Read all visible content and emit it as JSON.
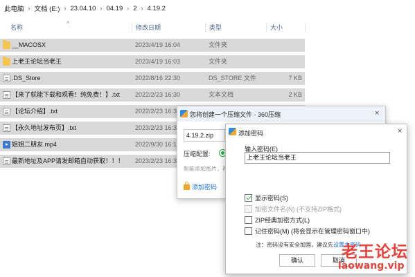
{
  "breadcrumb": [
    "此电脑",
    "文档 (E:)",
    "23.04.10",
    "04.19",
    "2",
    "4.19.2"
  ],
  "columns": {
    "name": "名称",
    "date": "修改日期",
    "type": "类型",
    "size": "大小"
  },
  "files": [
    {
      "name": "__MACOSX",
      "date": "2023/4/19 16:04",
      "type": "文件夹",
      "size": "",
      "icon": "folder-icon"
    },
    {
      "name": "上老王论坛当老王",
      "date": "2023/4/19 16:03",
      "type": "文件夹",
      "size": "",
      "icon": "folder-icon"
    },
    {
      "name": ".DS_Store",
      "date": "2022/8/16 22:30",
      "type": "DS_STORE 文件",
      "size": "7 KB",
      "icon": "file-icon"
    },
    {
      "name": "【来了就能下载和观看！纯免费！】.txt",
      "date": "2022/2/23 16:30",
      "type": "文本文档",
      "size": "2 KB",
      "icon": "text-file-icon"
    },
    {
      "name": "【论坛介绍】.txt",
      "date": "2022/2/23 16:30",
      "type": "",
      "size": "",
      "icon": "text-file-icon"
    },
    {
      "name": "【永久地址发布页】.txt",
      "date": "2023/2/23 16:30",
      "type": "",
      "size": "",
      "icon": "text-file-icon"
    },
    {
      "name": "姐姐二朋友.mp4",
      "date": "2022/9/30 16:10",
      "type": "",
      "size": "",
      "icon": "video-file-icon"
    },
    {
      "name": "最新地址及APP请发邮箱自动获取！！！",
      "date": "2023/2/23 16:30",
      "type": "",
      "size": "",
      "icon": "text-file-icon"
    }
  ],
  "compress_dialog": {
    "title": "您将创建一个压缩文件 - 360压缩",
    "filename": "4.19.2.zip",
    "config_label": "压缩配置:",
    "hint": "智能添加图片，视",
    "add_password": "添加密码",
    "close": "×"
  },
  "password_dialog": {
    "title": "添加密码",
    "close": "×",
    "input_label": "输入密码(E)",
    "password_value": "上老王论坛当老王",
    "options": [
      {
        "label": "显示密码(S)",
        "checked": true,
        "disabled": false
      },
      {
        "label": "加密文件名(N) (不支持ZIP格式)",
        "checked": false,
        "disabled": true
      },
      {
        "label": "ZIP经典加密方式(L)",
        "checked": false,
        "disabled": false
      },
      {
        "label": "记住密码(M) (将会显示在管理密码窗口中)",
        "checked": false,
        "disabled": false
      }
    ],
    "note_prefix": "注：密码没有安全加固，建议先",
    "note_link": "设置主密码",
    "ok": "确认",
    "cancel": "取消"
  },
  "watermark": {
    "line1": "老王论坛",
    "line2": "laowang.vip"
  }
}
